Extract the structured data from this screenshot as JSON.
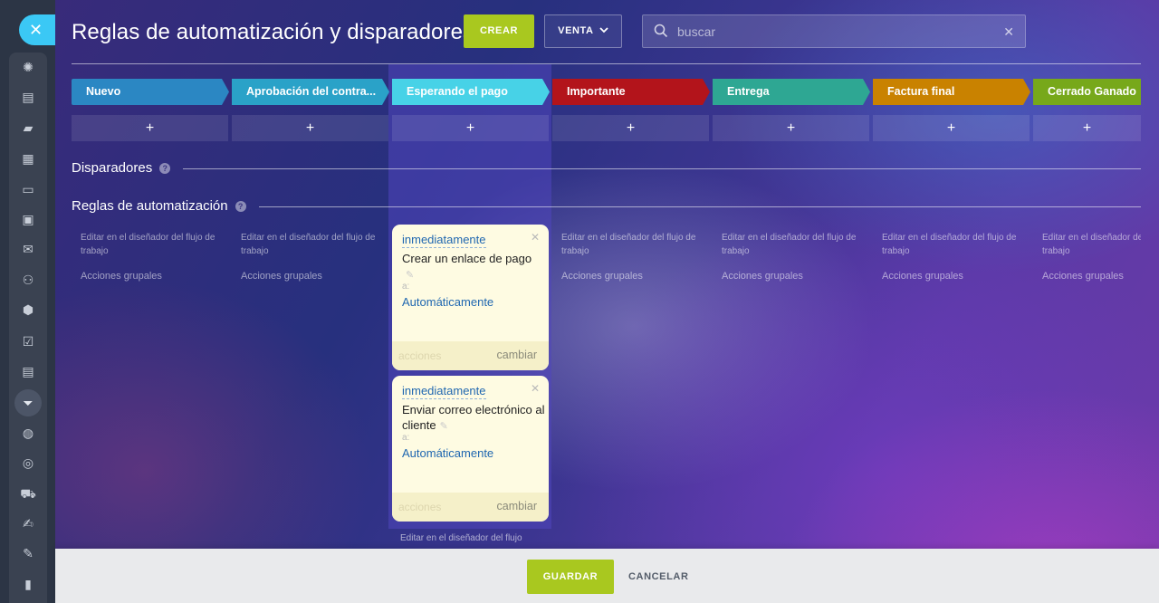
{
  "header": {
    "title": "Reglas de automatización y disparadores",
    "create_label": "CREAR",
    "pipeline_label": "VENTA",
    "search_placeholder": "buscar"
  },
  "stages": [
    {
      "label": "Nuevo",
      "color": "#2b87c3"
    },
    {
      "label": "Aprobación del contra...",
      "color": "#2aa2c8"
    },
    {
      "label": "Esperando el pago",
      "color": "#47d2e7"
    },
    {
      "label": "Importante",
      "color": "#b3141b"
    },
    {
      "label": "Entrega",
      "color": "#2ea793"
    },
    {
      "label": "Factura final",
      "color": "#c98200"
    },
    {
      "label": "Cerrado Ganado",
      "color": "#77a81a"
    }
  ],
  "add_label": "+",
  "sections": {
    "triggers": "Disparadores",
    "rules": "Reglas de automatización",
    "help": "?"
  },
  "column_note": {
    "edit": "Editar en el diseñador del flujo de trabajo",
    "edit_truncated": "Editar en el diseñador del flujo",
    "group": "Acciones grupales"
  },
  "rule_cards": [
    {
      "timing": "inmediatamente",
      "action": "Crear un enlace de pago",
      "to_label": "a:",
      "responsible": "Automáticamente",
      "actions_label": "acciones",
      "change_label": "cambiar"
    },
    {
      "timing": "inmediatamente",
      "action": "Enviar correo electrónico al cliente",
      "to_label": "a:",
      "responsible": "Automáticamente",
      "actions_label": "acciones",
      "change_label": "cambiar"
    }
  ],
  "footer": {
    "save_label": "GUARDAR",
    "cancel_label": "CANCELAR"
  },
  "sidebar_icons": [
    "close-icon",
    "pulse-icon",
    "feed-icon",
    "chat-icon",
    "calendar-icon",
    "drive-icon",
    "document-icon",
    "mail-icon",
    "contacts-icon",
    "crm-icon",
    "tasks-icon",
    "contact-card-icon",
    "funnel-icon",
    "robot-icon",
    "target-icon",
    "shop-icon",
    "signature-icon",
    "forms-icon",
    "reports-icon"
  ]
}
